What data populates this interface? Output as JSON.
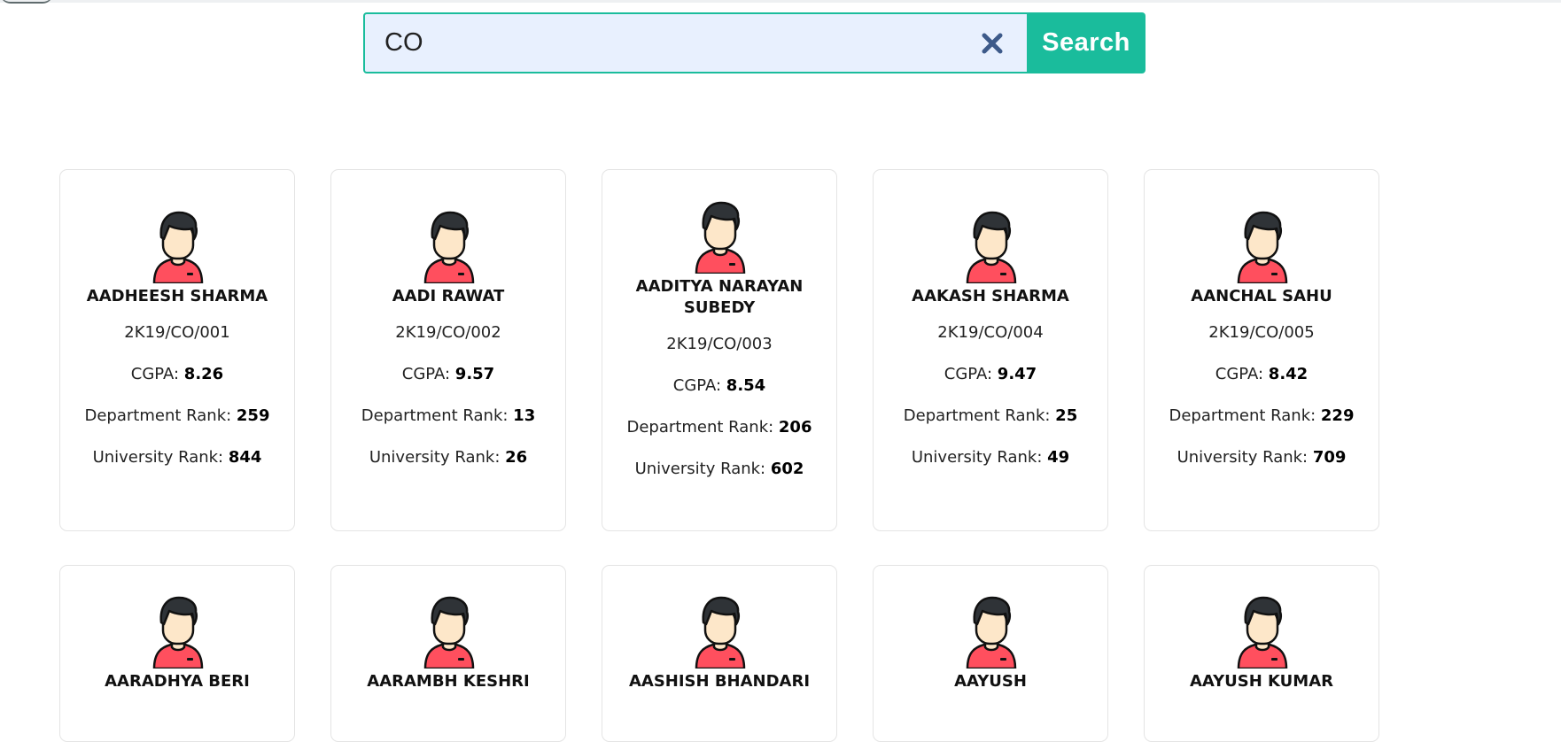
{
  "search": {
    "value": "CO",
    "button_label": "Search",
    "clear_icon": "close-icon"
  },
  "labels": {
    "cgpa": "CGPA: ",
    "dept_rank": "Department Rank: ",
    "univ_rank": "University Rank: "
  },
  "students": [
    {
      "name": "AADHEESH SHARMA",
      "roll": "2K19/CO/001",
      "cgpa": "8.26",
      "dept_rank": "259",
      "univ_rank": "844"
    },
    {
      "name": "AADI RAWAT",
      "roll": "2K19/CO/002",
      "cgpa": "9.57",
      "dept_rank": "13",
      "univ_rank": "26"
    },
    {
      "name": "AADITYA NARAYAN SUBEDY",
      "roll": "2K19/CO/003",
      "cgpa": "8.54",
      "dept_rank": "206",
      "univ_rank": "602"
    },
    {
      "name": "AAKASH SHARMA",
      "roll": "2K19/CO/004",
      "cgpa": "9.47",
      "dept_rank": "25",
      "univ_rank": "49"
    },
    {
      "name": "AANCHAL SAHU",
      "roll": "2K19/CO/005",
      "cgpa": "8.42",
      "dept_rank": "229",
      "univ_rank": "709"
    },
    {
      "name": "AARADHYA BERI"
    },
    {
      "name": "AARAMBH KESHRI"
    },
    {
      "name": "AASHISH BHANDARI"
    },
    {
      "name": "AAYUSH"
    },
    {
      "name": "AAYUSH KUMAR"
    }
  ],
  "colors": {
    "accent": "#1abc9c",
    "input_bg": "#e8f0fe",
    "clear_icon": "#3d5a8a",
    "avatar_shirt": "#ff4f5e",
    "avatar_skin": "#fde7c9",
    "avatar_hair": "#2f3337"
  }
}
